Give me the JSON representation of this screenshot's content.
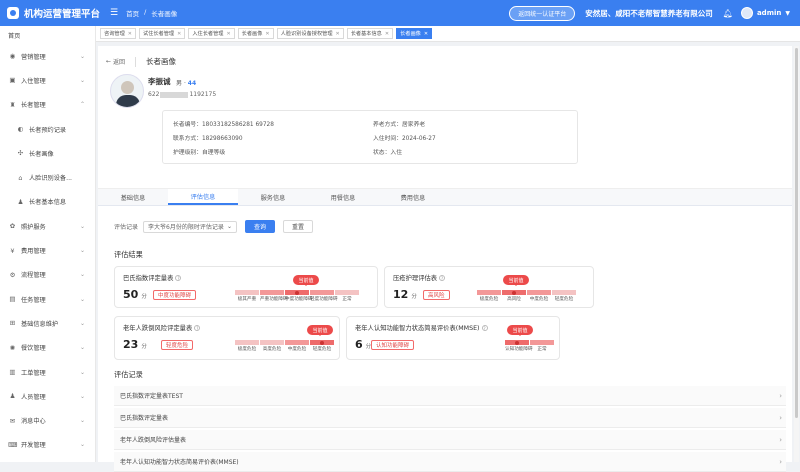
{
  "topbar": {
    "title": "机构运营管理平台",
    "breadcrumb": [
      "首页",
      "/",
      "长者画像"
    ],
    "switch_btn": "返回统一认证平台",
    "org_name": "安然居、咸阳不老帮智慧养老有限公司",
    "username": "admin"
  },
  "sidebar": {
    "items": [
      {
        "label": "首页",
        "icon": "home-icon",
        "glyph": "",
        "arrow": ""
      },
      {
        "label": "营销管理",
        "icon": "marketing-icon",
        "glyph": "◉",
        "arrow": "⌄"
      },
      {
        "label": "入住管理",
        "icon": "checkin-icon",
        "glyph": "▣",
        "arrow": "⌄"
      },
      {
        "label": "长者管理",
        "icon": "elder-icon",
        "glyph": "♜",
        "arrow": "⌃"
      },
      {
        "label": "长者预约记录",
        "icon": "record-icon",
        "glyph": "◐",
        "arrow": "",
        "sub": true
      },
      {
        "label": "长者画像",
        "icon": "portrait-icon",
        "glyph": "✣",
        "arrow": "",
        "sub": true
      },
      {
        "label": "人脸识别设备...",
        "icon": "face-device-icon",
        "glyph": "⌂",
        "arrow": "",
        "sub": true
      },
      {
        "label": "长者基本信息",
        "icon": "person-icon",
        "glyph": "♟",
        "arrow": "",
        "sub": true
      },
      {
        "label": "照护服务",
        "icon": "care-icon",
        "glyph": "✿",
        "arrow": "⌄"
      },
      {
        "label": "费用管理",
        "icon": "fee-icon",
        "glyph": "¥",
        "arrow": "⌄"
      },
      {
        "label": "流程管理",
        "icon": "flow-icon",
        "glyph": "⚙",
        "arrow": "⌄"
      },
      {
        "label": "任务管理",
        "icon": "task-icon",
        "glyph": "▤",
        "arrow": "⌄"
      },
      {
        "label": "基础信息维护",
        "icon": "base-info-icon",
        "glyph": "⊞",
        "arrow": "⌄"
      },
      {
        "label": "餐饮管理",
        "icon": "meal-icon",
        "glyph": "✺",
        "arrow": "⌄"
      },
      {
        "label": "工单管理",
        "icon": "workorder-icon",
        "glyph": "▥",
        "arrow": "⌄"
      },
      {
        "label": "人员管理",
        "icon": "staff-icon",
        "glyph": "♟",
        "arrow": "⌄"
      },
      {
        "label": "消息中心",
        "icon": "message-icon",
        "glyph": "✉",
        "arrow": "⌄"
      },
      {
        "label": "开发管理",
        "icon": "dev-icon",
        "glyph": "⌨",
        "arrow": "⌄"
      }
    ]
  },
  "tabs": [
    "咨询管理",
    "试住长者管理",
    "入住长者管理",
    "长者画像",
    "人脸识别设备授权管理",
    "长者基本信息",
    "长者画像"
  ],
  "header": {
    "back": "返回",
    "page_title": "长者画像"
  },
  "patient": {
    "name": "李振诚",
    "gender": "男",
    "age_sep": "·",
    "age": "44",
    "id_prefix": "622",
    "id_suffix": "1192175",
    "code": "长者编号：18033182586281 69728",
    "phone": "联系方式：18298663090",
    "care": "护理级别：自理等级",
    "pension": "养老方式：居家养老",
    "checkin": "入住时间：2024-06-27",
    "status": "状态：入住"
  },
  "section_tabs": [
    "基础信息",
    "评估信息",
    "服务信息",
    "用餐信息",
    "费用信息"
  ],
  "filter": {
    "label": "评估记录",
    "value": "李大爷6月份的限时评估记录",
    "query": "查询",
    "reset": "重置"
  },
  "results_title": "评估结果",
  "current_label": "当前值",
  "assessments": [
    {
      "title": "巴氏指数评定量表",
      "score": "50",
      "unit": "分",
      "tag": "中度功能障碍",
      "levels": [
        "极其严重",
        "严重功能障碍",
        "中度功能障碍",
        "轻度功能障碍",
        "正常"
      ]
    },
    {
      "title": "压疮护理评估表",
      "score": "12",
      "unit": "分",
      "tag": "高风险",
      "levels": [
        "极度危险",
        "高风险",
        "中度危险",
        "轻度危险"
      ]
    },
    {
      "title": "老年人跌倒风险评定量表",
      "score": "23",
      "unit": "分",
      "tag": "轻度危险",
      "levels": [
        "极度危险",
        "高度危险",
        "中度危险",
        "轻度危险"
      ]
    },
    {
      "title": "老年人认知功能智力状态简易评价表(MMSE)",
      "score": "6",
      "unit": "分",
      "tag": "认知功能障碍",
      "levels": [
        "认知功能障碍",
        "正常"
      ]
    }
  ],
  "records_title": "评估记录",
  "records": [
    "巴氏指数评定量表TEST",
    "巴氏指数评定量表",
    "老年人跌倒风险评估量表",
    "老年人认知功能智力状态简易评价表(MMSE)"
  ]
}
